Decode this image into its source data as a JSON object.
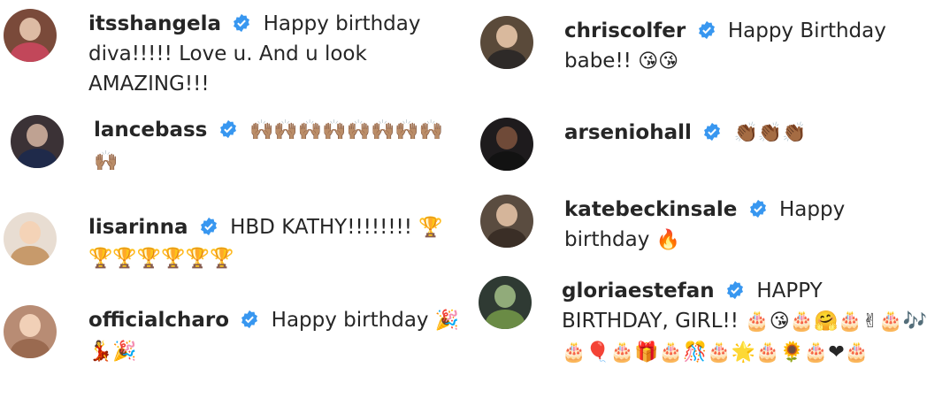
{
  "colors": {
    "verified": "#3897f0",
    "text": "#262626"
  },
  "left": [
    {
      "user": "itsshangela",
      "text": "Happy birthday diva!!!!! Love u. And u look AMAZING!!!",
      "emoji": ""
    },
    {
      "user": "lancebass",
      "text": "",
      "emoji": "🙌🏽🙌🏽🙌🏽🙌🏽🙌🏽🙌🏽🙌🏽🙌🏽🙌🏽"
    },
    {
      "user": "lisarinna",
      "text": "HBD KATHY!!!!!!!!",
      "emoji": "🏆🏆🏆🏆🏆🏆🏆"
    },
    {
      "user": "officialcharo",
      "text": "Happy birthday",
      "emoji": "🎉💃🎉"
    }
  ],
  "right": [
    {
      "user": "chriscolfer",
      "text": "Happy Birthday babe!!",
      "emoji": "😘😘"
    },
    {
      "user": "arseniohall",
      "text": "",
      "emoji": "👏🏾👏🏾👏🏾"
    },
    {
      "user": "katebeckinsale",
      "text": "Happy birthday",
      "emoji": "🔥"
    },
    {
      "user": "gloriaestefan",
      "text": "HAPPY BIRTHDAY, GIRL!!",
      "emoji": "🎂😘🎂🤗🎂✌🎂🎶🎂🎈🎂🎁🎂🎊🎂🌟🎂🌻🎂❤🎂"
    }
  ]
}
